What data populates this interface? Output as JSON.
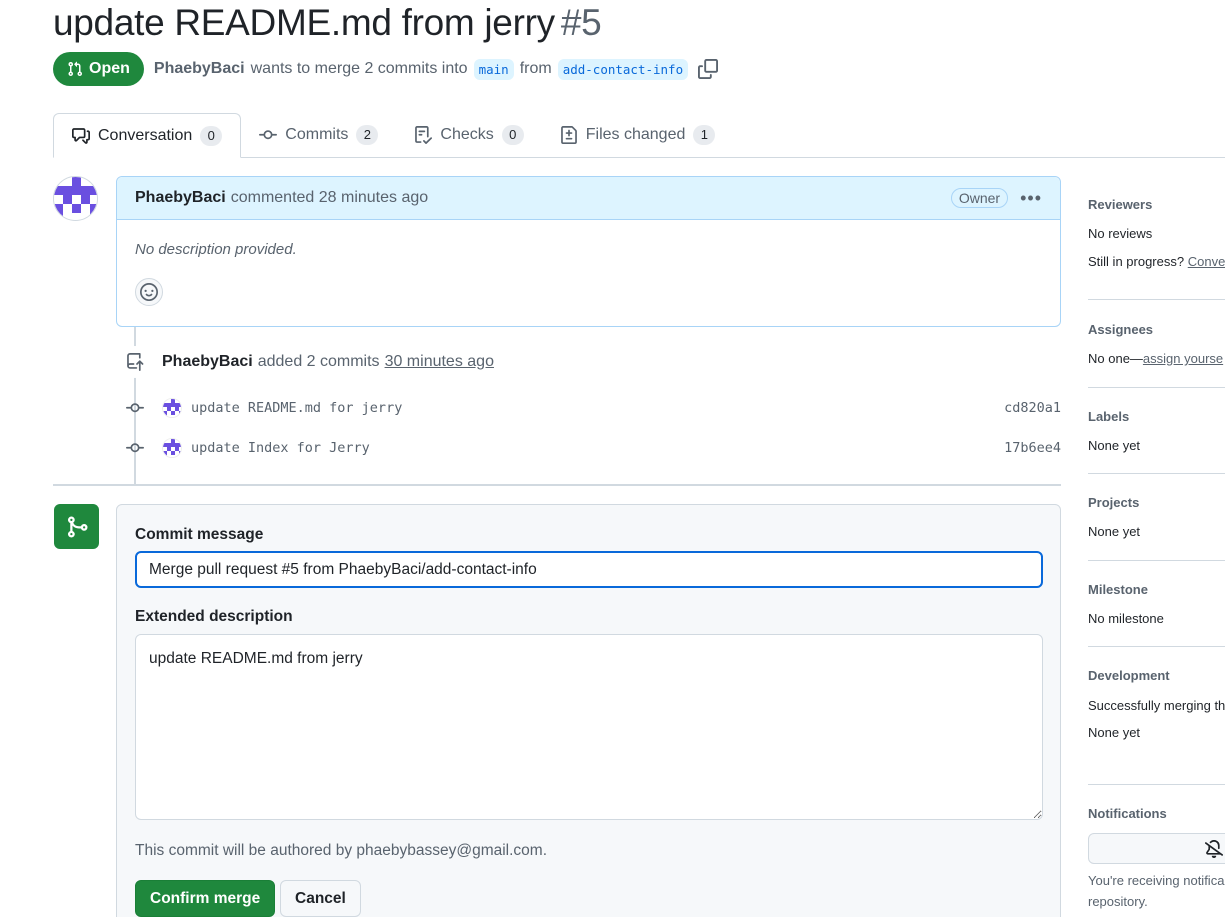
{
  "pr": {
    "title": "update README.md from jerry",
    "number": "#5",
    "state": "Open",
    "author": "PhaebyBaci",
    "merge_text": "wants to merge 2 commits into",
    "base_branch": "main",
    "from_text": "from",
    "head_branch": "add-contact-info"
  },
  "tabs": [
    {
      "label": "Conversation",
      "count": "0"
    },
    {
      "label": "Commits",
      "count": "2"
    },
    {
      "label": "Checks",
      "count": "0"
    },
    {
      "label": "Files changed",
      "count": "1"
    }
  ],
  "comment": {
    "author": "PhaebyBaci",
    "action": "commented 28 minutes ago",
    "badge": "Owner",
    "body": "No description provided."
  },
  "commit_event": {
    "author": "PhaebyBaci",
    "action": "added 2 commits",
    "time": "30 minutes ago"
  },
  "commits": [
    {
      "message": "update README.md for jerry",
      "sha": "cd820a1"
    },
    {
      "message": "update Index for Jerry",
      "sha": "17b6ee4"
    }
  ],
  "merge": {
    "commit_message_label": "Commit message",
    "commit_message": "Merge pull request #5 from PhaebyBaci/add-contact-info",
    "extended_label": "Extended description",
    "extended_description": "update README.md from jerry",
    "author_note": "This commit will be authored by phaebybassey@gmail.com.",
    "confirm_label": "Confirm merge",
    "cancel_label": "Cancel"
  },
  "sidebar": {
    "reviewers_title": "Reviewers",
    "reviewers_value": "No reviews",
    "in_progress_text": "Still in progress?",
    "in_progress_link": "Conve",
    "assignees_title": "Assignees",
    "assignees_none": "No one—",
    "assignees_link": "assign yourse",
    "labels_title": "Labels",
    "labels_value": "None yet",
    "projects_title": "Projects",
    "projects_value": "None yet",
    "milestone_title": "Milestone",
    "milestone_value": "No milestone",
    "development_title": "Development",
    "development_text": "Successfully merging th issues.",
    "development_value": "None yet",
    "notifications_title": "Notifications",
    "notifications_text": "You're receiving notifica this repository."
  },
  "colors": {
    "accent_green": "#1f883d",
    "link_blue": "#0969da",
    "comment_header": "#ddf4ff"
  },
  "icons": [
    "git-pull-request-icon",
    "copy-icon",
    "comment-discussion-icon",
    "git-commit-icon",
    "checklist-icon",
    "file-diff-icon",
    "smiley-icon",
    "kebab-horizontal-icon",
    "repo-push-icon",
    "git-merge-icon",
    "bell-slash-icon"
  ]
}
